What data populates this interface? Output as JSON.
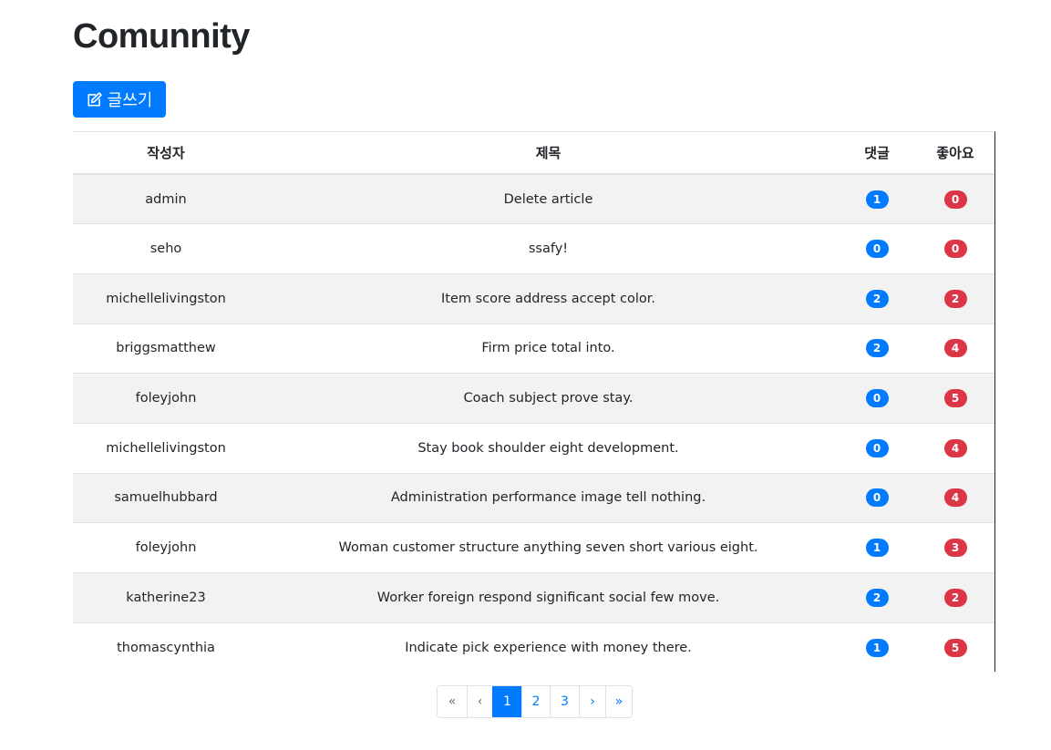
{
  "title": "Comunnity",
  "write_button": {
    "label": "글쓰기",
    "icon": "pencil-square-icon"
  },
  "table": {
    "headers": [
      "작성자",
      "제목",
      "댓글",
      "좋아요"
    ],
    "rows": [
      {
        "author": "admin",
        "title": "Delete article",
        "comments": "1",
        "likes": "0"
      },
      {
        "author": "seho",
        "title": "ssafy!",
        "comments": "0",
        "likes": "0"
      },
      {
        "author": "michellelivingston",
        "title": "Item score address accept color.",
        "comments": "2",
        "likes": "2"
      },
      {
        "author": "briggsmatthew",
        "title": "Firm price total into.",
        "comments": "2",
        "likes": "4"
      },
      {
        "author": "foleyjohn",
        "title": "Coach subject prove stay.",
        "comments": "0",
        "likes": "5"
      },
      {
        "author": "michellelivingston",
        "title": "Stay book shoulder eight development.",
        "comments": "0",
        "likes": "4"
      },
      {
        "author": "samuelhubbard",
        "title": "Administration performance image tell nothing.",
        "comments": "0",
        "likes": "4"
      },
      {
        "author": "foleyjohn",
        "title": "Woman customer structure anything seven short various eight.",
        "comments": "1",
        "likes": "3"
      },
      {
        "author": "katherine23",
        "title": "Worker foreign respond significant social few move.",
        "comments": "2",
        "likes": "2"
      },
      {
        "author": "thomascynthia",
        "title": "Indicate pick experience with money there.",
        "comments": "1",
        "likes": "5"
      }
    ]
  },
  "pagination": {
    "first": "«",
    "prev": "‹",
    "pages": [
      "1",
      "2",
      "3"
    ],
    "active_page": "1",
    "next": "›",
    "last": "»"
  },
  "colors": {
    "primary": "#007bff",
    "danger": "#dc3545",
    "stripe": "#f2f2f2"
  }
}
